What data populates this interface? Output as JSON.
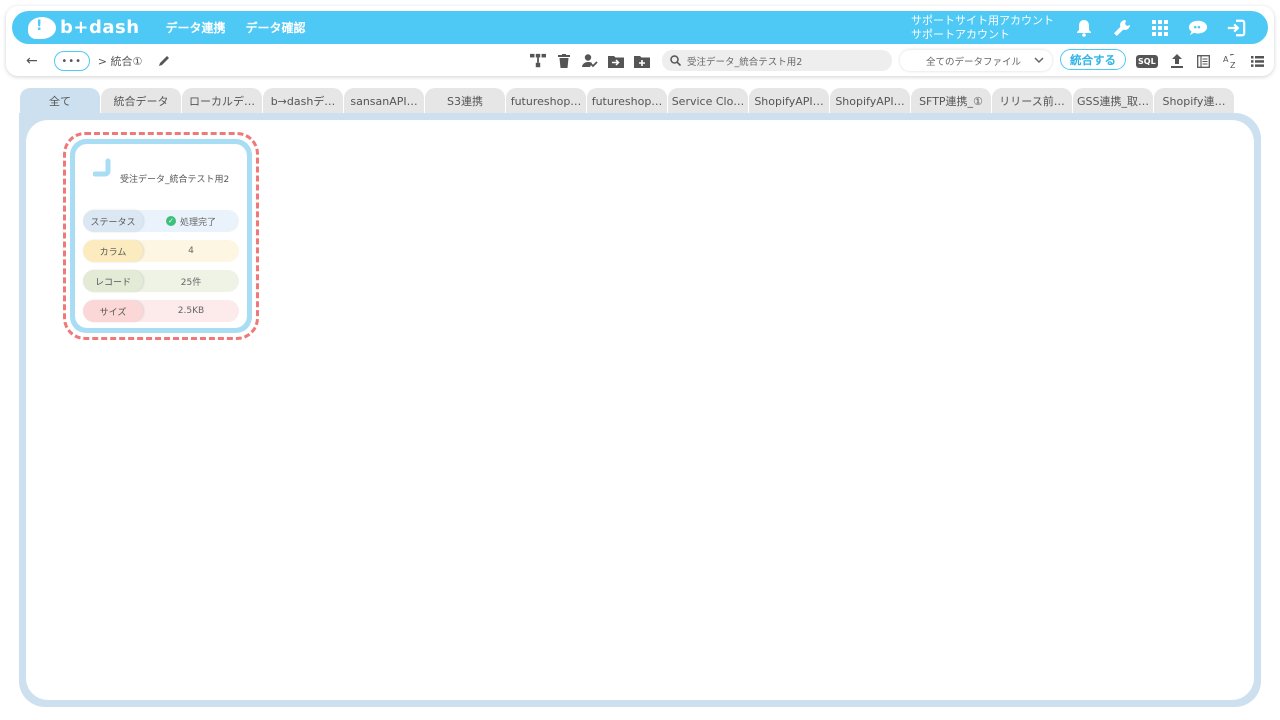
{
  "header": {
    "logo_text": "b+dash",
    "nav": [
      "データ連携",
      "データ確認"
    ],
    "account_line1": "サポートサイト用アカウント",
    "account_line2": "サポートアカウント",
    "icons": [
      "bell-icon",
      "wrench-icon",
      "apps-grid-icon",
      "ai-bubble-icon",
      "logout-icon"
    ],
    "accent_color": "#4ec9f5"
  },
  "subbar": {
    "dots": "•••",
    "breadcrumb": "> 統合①",
    "search_value": "受注データ_統合テスト用2",
    "file_filter": "全てのデータファイル",
    "merge_button": "統合する",
    "sql_label": "SQL"
  },
  "tabs": [
    "全て",
    "統合データ",
    "ローカルデ…",
    "b→dashデ…",
    "sansanAPI…",
    "S3連携",
    "futureshop…",
    "futureshop…",
    "Service Clo…",
    "ShopifyAPI…",
    "ShopifyAPI…",
    "SFTP連携_①",
    "リリース前…",
    "GSS連携_取…",
    "Shopify連…"
  ],
  "card": {
    "title": "受注データ_統合テスト用2",
    "rows": [
      {
        "label": "ステータス",
        "value": "処理完了"
      },
      {
        "label": "カラム",
        "value": "4"
      },
      {
        "label": "レコード",
        "value": "25件"
      },
      {
        "label": "サイズ",
        "value": "2.5KB"
      }
    ]
  }
}
